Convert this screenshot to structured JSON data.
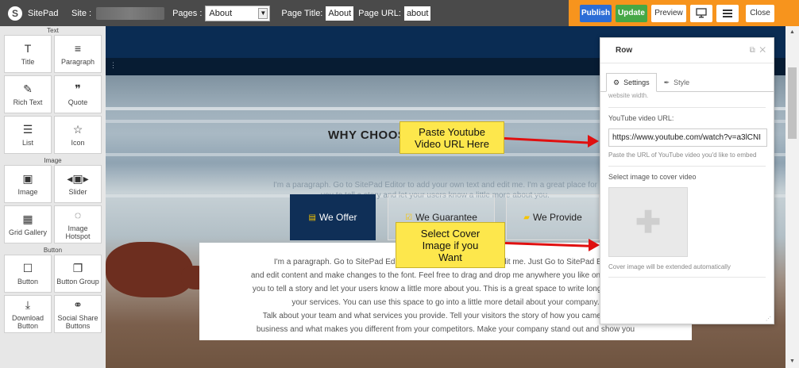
{
  "app": {
    "name": "SitePad",
    "logo_icon": "sitepad-logo-icon"
  },
  "toolbar": {
    "site_label": "Site :",
    "pages_label": "Pages :",
    "pages_selected": "About",
    "page_title_label": "Page Title:",
    "page_title_value": "About",
    "page_url_label": "Page URL:",
    "page_url_value": "about",
    "publish": "Publish",
    "update": "Update",
    "preview": "Preview",
    "close": "Close",
    "accent_color": "#f7941d"
  },
  "sidebar": {
    "sections": [
      {
        "title": "Text",
        "widgets": [
          {
            "label": "Title",
            "icon": "T"
          },
          {
            "label": "Paragraph",
            "icon": "≡"
          },
          {
            "label": "Rich Text",
            "icon": "✎"
          },
          {
            "label": "Quote",
            "icon": "❞"
          },
          {
            "label": "List",
            "icon": "☰"
          },
          {
            "label": "Icon",
            "icon": "☆"
          }
        ]
      },
      {
        "title": "Image",
        "widgets": [
          {
            "label": "Image",
            "icon": "▣"
          },
          {
            "label": "Slider",
            "icon": "◂▣▸"
          },
          {
            "label": "Grid Gallery",
            "icon": "▦"
          },
          {
            "label": "Image Hotspot",
            "icon": "◌"
          }
        ]
      },
      {
        "title": "Button",
        "widgets": [
          {
            "label": "Button",
            "icon": "☐"
          },
          {
            "label": "Button Group",
            "icon": "❐"
          },
          {
            "label": "Download Button",
            "icon": "⤓"
          },
          {
            "label": "Social Share Buttons",
            "icon": "⚭"
          }
        ]
      }
    ]
  },
  "canvas": {
    "heading": "WHY CHOOSE ELECTRICIAN",
    "intro": "I'm a paragraph. Go to SitePad Editor to add your own text and edit me. I'm a great place for you to tell a story and let your users know a little more about you.",
    "tabs": [
      {
        "label": "We Offer"
      },
      {
        "label": "We Guarantee"
      },
      {
        "label": "We Provide"
      }
    ],
    "content_lines": [
      "I'm a paragraph. Go to SitePad Editor to add your own text and edit me. Just Go to SitePad Editor",
      "and edit content and make changes to the font. Feel free to drag and drop me anywhere you like on your page.",
      "you to tell a story and let your users know a little more about you. This is a great space to write long text about",
      "your services. You can use this space to go into a little more detail about your company.",
      "Talk about your team and what services you provide. Tell your visitors the story of how you came up with",
      "business and what makes you different from your competitors. Make your company stand out and show you"
    ],
    "callout_youtube": [
      "Paste Youtube",
      "Video URL Here"
    ],
    "callout_cover": [
      "Select Cover",
      "Image if you",
      "Want"
    ]
  },
  "panel": {
    "title": "Row",
    "tab_settings": "Settings",
    "tab_style": "Style",
    "cut_text": "website width.",
    "youtube_label": "YouTube video URL:",
    "youtube_value": "https://www.youtube.com/watch?v=a3lCNI",
    "youtube_hint": "Paste the URL of YouTube video you'd like to embed",
    "cover_label": "Select image to cover video",
    "cover_hint": "Cover image will be extended automatically"
  }
}
